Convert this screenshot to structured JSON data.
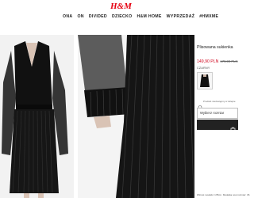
{
  "header": {
    "logo": "H&M",
    "nav": [
      "ONA",
      "ON",
      "DIVIDED",
      "DZIECKO",
      "H&M HOME",
      "WYPRZEDAŻ",
      "#HMXME"
    ]
  },
  "product": {
    "title": "Plisowana sukienka",
    "price": "149,90 PLN",
    "old_price": "179,90 PLN",
    "color_label": "CZARNY",
    "store_text": "Produkt niedostępny w sklepie",
    "size_select": "Wybierz rozmiar",
    "model_info": "Wzrost modelki: 178cm. Modelka nosi rozmiar: 36"
  },
  "colors": {
    "brand": "#e50010",
    "price": "#d0021b",
    "button": "#222222"
  },
  "icons": {
    "store": "map-pin-icon",
    "cart": "shopping-bag-icon"
  }
}
